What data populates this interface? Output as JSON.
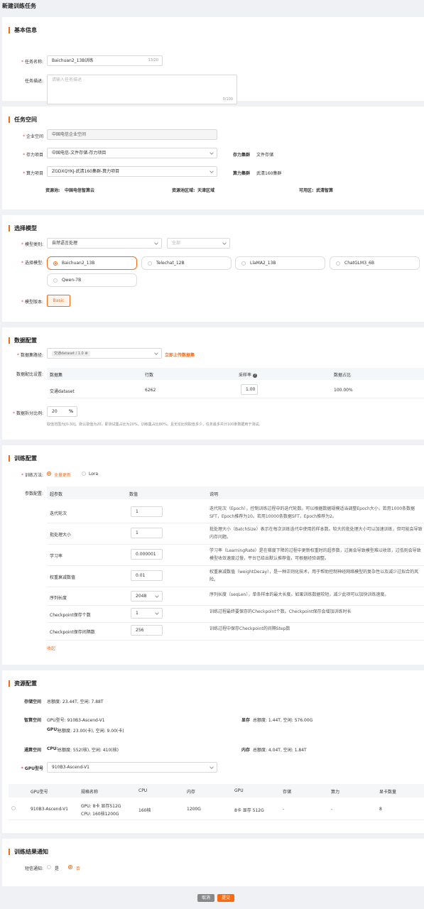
{
  "page_title": "新建训练任务",
  "basic": {
    "title": "基本信息",
    "name_label": "任务名称:",
    "name_value": "Baichuan2_13B训练",
    "name_count": "13/20",
    "desc_label": "任务描述:",
    "desc_placeholder": "请输入任务描述",
    "desc_count": "0/100"
  },
  "space": {
    "title": "任务空间",
    "enterprise_label": "企业空间",
    "enterprise_value": "中国电信企业空间",
    "storage_label": "存力项目",
    "storage_value": "中国电信-文件存储-存力项目",
    "storage_cluster_label": "存力集群",
    "storage_cluster_value": "文件存储",
    "compute_label": "算力项目",
    "compute_value": "ZGDXQYKJ-武清160集群-算力项目",
    "compute_cluster_label": "算力集群",
    "compute_cluster_value": "武清160集群",
    "pool_label": "资源池:",
    "pool_value": "中国电信智算云",
    "region_label": "资源池区域:",
    "region_value": "天津区域",
    "zone_label": "可用区:",
    "zone_value": "武清智算"
  },
  "model": {
    "title": "选择模型",
    "category_label": "模型类别:",
    "category_value": "自然语言处理",
    "sub_value": "全部",
    "select_label": "选择模型:",
    "options": [
      {
        "name": "Baichuan2_13B",
        "selected": true
      },
      {
        "name": "Telechat_12B",
        "selected": false
      },
      {
        "name": "LlaMA2_13B",
        "selected": false
      },
      {
        "name": "ChatGLM3_6B",
        "selected": false
      },
      {
        "name": "Qwen-7B",
        "selected": false
      }
    ],
    "version_label": "模型版本:",
    "version_value": "Basic"
  },
  "data": {
    "title": "数据配置",
    "path_label": "数据集路径:",
    "path_chip": "交通dataset / 1.0",
    "upload_link": "立即上传数据集",
    "ratio_label": "数据配比设置:",
    "columns": [
      "数据集",
      "行数",
      "采样率",
      "数据占比"
    ],
    "row": {
      "dataset": "交通dataset",
      "rows": "6262",
      "rate": "1.00",
      "share": "100.00%"
    },
    "split_label": "数据拆分比例:",
    "split_value": "20",
    "split_unit": "%",
    "split_hint": "取值范围为[0-30]。默认取值为20，即测试集占比为20%，训练集占比80%。且无论比例取值多少，任务最多共计100条数据用于测试。"
  },
  "train": {
    "title": "训练配置",
    "method_label": "训练方法:",
    "method_full": "全量更新",
    "method_lora": "Lora",
    "params_label": "参数配置:",
    "columns": [
      "超参数",
      "数值",
      "说明"
    ],
    "rows": [
      {
        "name": "迭代轮次",
        "value": "1",
        "select": false,
        "desc": "迭代轮次（Epoch），控制训练过程中的迭代轮数。可以根据数据规模适当调整Epoch大小，若用1000条数据SFT，Epoch推荐为10。若用10000条数据SFT，Epoch推荐为2。"
      },
      {
        "name": "批处理大小",
        "value": "1",
        "select": false,
        "desc": "批处理大小（BatchSize）表示在每次训练迭代中使用的样本数。较大的批处理大小可以加速训练，但可能会导致内存问题。"
      },
      {
        "name": "学习率",
        "value": "0.000001",
        "select": false,
        "desc": "学习率（LearningRate）是在梯度下降的过程中更新权重时的超参数，过高会导致模型难以收敛，过低则会导致模型收敛速度过慢，平台已给出默认推荐值，可根据经验调整。"
      },
      {
        "name": "权重衰减数值",
        "value": "0.01",
        "select": false,
        "desc": "权重衰减数值（weightDecay），是一种正则化技术，用于帮助控制神经网络模型的复杂性以及减少过拟合的风险。"
      },
      {
        "name": "序列长度",
        "value": "2048",
        "select": true,
        "desc": "序列长度（seqLen），单条样本的最大长度。如果训练数据较短，减少此项可以加快训练速度。"
      },
      {
        "name": "Checkpoint保存个数",
        "value": "1",
        "select": true,
        "desc": "训练过程最终要保存的Checkpoint个数。Checkpoint保存会增加训练时长"
      },
      {
        "name": "Checkpoint保存间隔数",
        "value": "256",
        "select": false,
        "desc": "训练过程中保存Checkpoint的间隔Step数"
      }
    ],
    "collapse": "收起"
  },
  "resource": {
    "title": "资源配置",
    "storage_label": "存储空间",
    "storage_value": "总额度: 23.44T, 空闲: 7.88T",
    "ai_label": "智算空间",
    "ai_gpu_model": "GPU型号: 910B3-Ascend-V1",
    "ai_vram_label": "显存",
    "ai_vram_value": "总额度: 1.44T, 空闲: 576.00G",
    "ai_gpu_label": "GPU:",
    "ai_gpu_value": "总额度: 23.00(卡), 空闲: 9.00(卡)",
    "general_label": "通算空间",
    "general_cpu_label": "CPU:",
    "general_cpu_value": "总额度: 552(核), 空闲: 410(核)",
    "general_mem_label": "内存",
    "general_mem_value": "总额度: 4.04T, 空闲: 1.84T",
    "gpu_model_label": "GPU型号",
    "gpu_model_value": "910B3-Ascend-V1",
    "columns": [
      "GPU型号",
      "规格名称",
      "CPU",
      "内存",
      "GPU",
      "存储",
      "算力",
      "显卡数量"
    ],
    "row": {
      "model": "910B3-Ascend-V1",
      "spec": "GPU: 8卡 显存512G CPU: 160核1200G",
      "cpu": "160核",
      "mem": "1200G",
      "gpu": "8卡 显存 512G",
      "storage": "-",
      "compute": "-",
      "count": "8"
    }
  },
  "notify": {
    "title": "训练结果通知",
    "sms_label": "短信通知:",
    "yes": "是",
    "no": "否"
  },
  "footer": {
    "cancel": "取消",
    "submit": "提交"
  },
  "colors": {
    "accent": "#f76b15",
    "required": "#f53f3f",
    "background": "#f0f1f5"
  }
}
